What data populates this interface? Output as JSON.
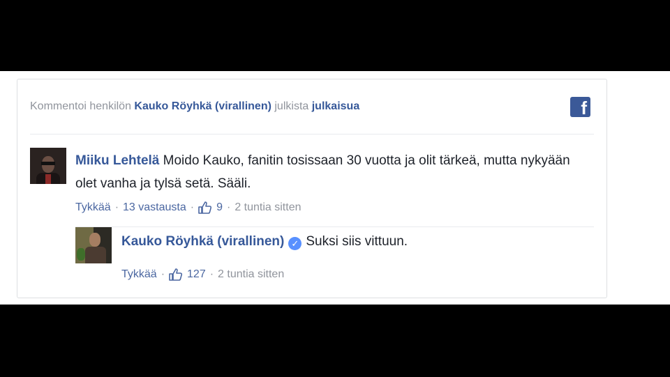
{
  "header": {
    "prefix": "Kommentoi henkilön",
    "page_name": "Kauko Röyhkä (virallinen)",
    "middle": "julkista",
    "post_link": "julkaisua",
    "logo_icon": "facebook-logo-icon",
    "logo_letter": "f"
  },
  "comments": [
    {
      "author": "Miiku Lehtelä",
      "text": "Moido Kauko, fanitin tosissaan 30 vuotta ja olit tärkeä, mutta nykyään olet vanha ja tylsä setä. Sääli.",
      "like_label": "Tykkää",
      "replies_label": "13 vastausta",
      "like_count": "9",
      "time": "2 tuntia sitten"
    },
    {
      "author": "Kauko Röyhkä (virallinen)",
      "verified_icon": "verified-check-icon",
      "verified_glyph": "✓",
      "text": "Suksi siis vittuun.",
      "like_label": "Tykkää",
      "like_count": "127",
      "time": "2 tuntia sitten"
    }
  ],
  "separator": "·",
  "colors": {
    "link": "#365899",
    "muted": "#90949c",
    "facebook_blue": "#3b5998",
    "verified": "#5890ff"
  }
}
